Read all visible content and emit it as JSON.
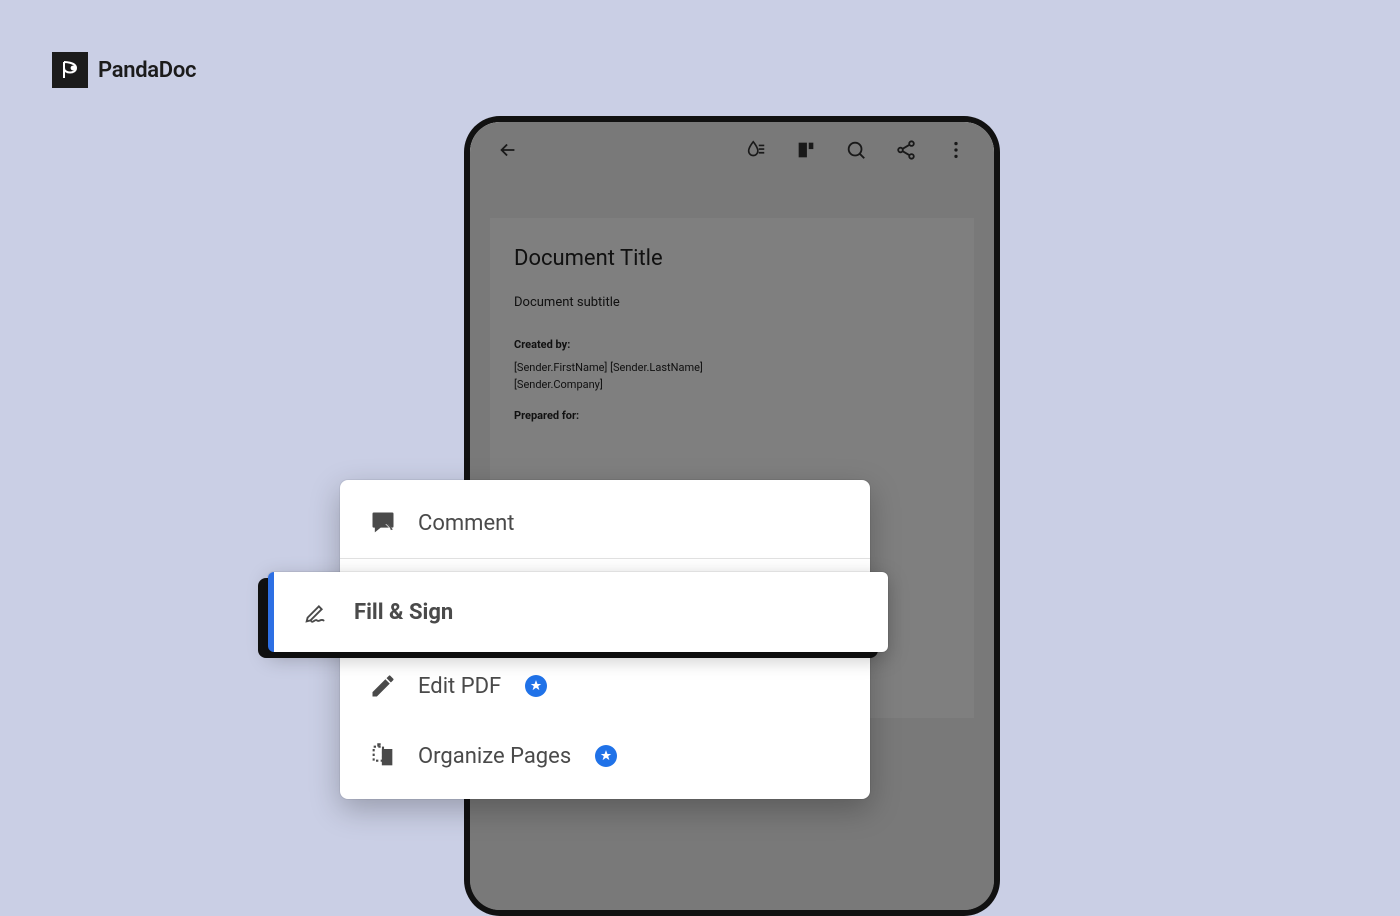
{
  "brand": {
    "name": "PandaDoc"
  },
  "document": {
    "title": "Document Title",
    "subtitle": "Document subtitle",
    "created_label": "Created by:",
    "sender_name": "[Sender.FirstName] [Sender.LastName]",
    "sender_company": "[Sender.Company]",
    "prepared_label": "Prepared for:"
  },
  "menu": {
    "comment": "Comment",
    "fill_sign": "Fill & Sign",
    "edit_pdf": "Edit PDF",
    "organize": "Organize Pages"
  }
}
